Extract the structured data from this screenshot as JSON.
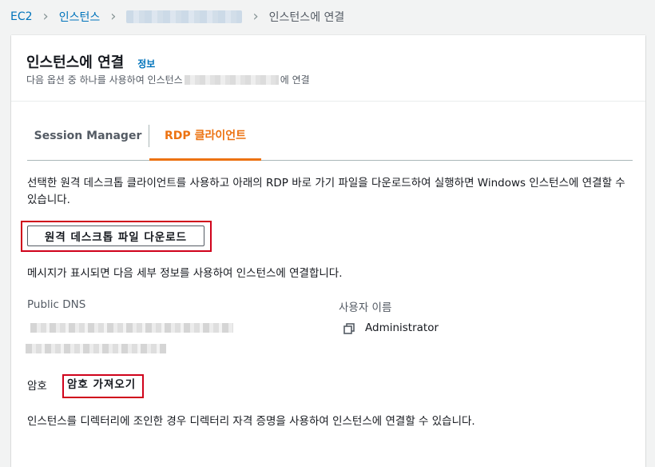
{
  "breadcrumb": {
    "ec2": "EC2",
    "instances": "인스턴스",
    "current": "인스턴스에 연결"
  },
  "header": {
    "title": "인스턴스에 연결",
    "info": "정보",
    "subtitle_prefix": "다음 옵션 중 하나를 사용하여 인스턴스",
    "subtitle_suffix": "에 연결"
  },
  "tabs": [
    {
      "label": "Session Manager",
      "selected": false
    },
    {
      "label": "RDP 클라이언트",
      "selected": true
    }
  ],
  "rdp": {
    "description": "선택한 원격 데스크톱 클라이언트를 사용하고 아래의 RDP 바로 가기 파일을 다운로드하여 실행하면 Windows 인스턴스에 연결할 수 있습니다.",
    "download_button": "원격 데스크톱 파일 다운로드",
    "prompt_message": "메시지가 표시되면 다음 세부 정보를 사용하여 인스턴스에 연결합니다.",
    "public_dns_label": "Public DNS",
    "username_label": "사용자 이름",
    "username_value": "Administrator",
    "password_label": "암호",
    "get_password_link": "암호 가져오기",
    "ad_note": "인스턴스를 디렉터리에 조인한 경우 디렉터리 자격 증명을 사용하여 인스턴스에 연결할 수 있습니다."
  },
  "icons": {
    "copy": "copy-icon",
    "breadcrumb_separator": "chevron-right-icon"
  },
  "colors": {
    "link": "#0073bb",
    "active_tab": "#ec7211",
    "highlight_box": "#d0021b"
  }
}
